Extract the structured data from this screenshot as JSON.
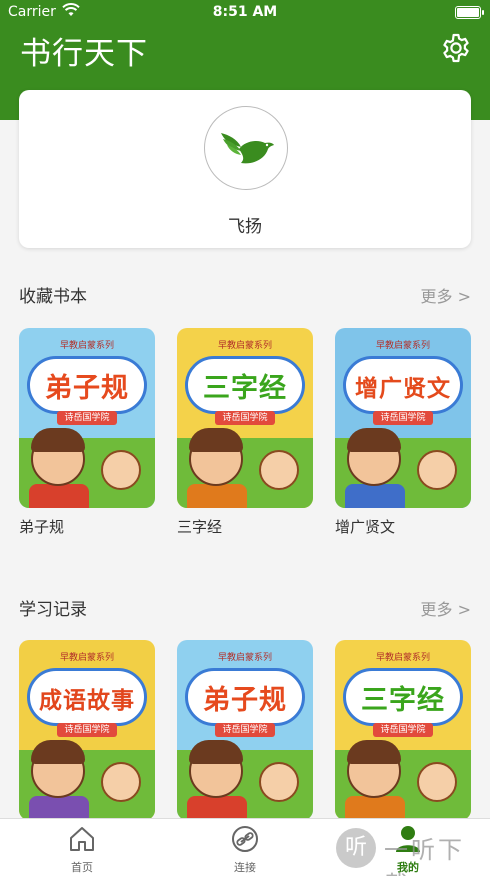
{
  "status_bar": {
    "carrier": "Carrier",
    "time": "8:51 AM"
  },
  "header": {
    "title": "书行天下",
    "settings_icon": "gear-icon"
  },
  "profile": {
    "username": "飞扬",
    "avatar_icon": "bird-book-logo"
  },
  "favorites": {
    "title": "收藏书本",
    "more": "更多 >",
    "books": [
      {
        "cover_series": "早教启蒙系列",
        "cover_title": "弟子规",
        "cover_publisher": "诗岳国学院",
        "label": "弟子规",
        "title_color": "#e64a1e",
        "sky_color": "#8fd0ef",
        "robe_color": "#d8402c"
      },
      {
        "cover_series": "早教启蒙系列",
        "cover_title": "三字经",
        "cover_publisher": "诗岳国学院",
        "label": "三字经",
        "title_color": "#3aa51c",
        "sky_color": "#f4d24a",
        "robe_color": "#e07a1c"
      },
      {
        "cover_series": "早教启蒙系列",
        "cover_title": "增广贤文",
        "cover_publisher": "诗岳国学院",
        "label": "增广贤文",
        "title_color": "#e44a1c",
        "sky_color": "#7fc4ea",
        "robe_color": "#3f6ec9"
      }
    ]
  },
  "history": {
    "title": "学习记录",
    "more": "更多 >",
    "books": [
      {
        "cover_series": "早教启蒙系列",
        "cover_title": "成语故事",
        "cover_publisher": "诗岳国学院",
        "title_color": "#e2461c",
        "sky_color": "#f2cf45",
        "robe_color": "#7a4fb0"
      },
      {
        "cover_series": "早教启蒙系列",
        "cover_title": "弟子规",
        "cover_publisher": "诗岳国学院",
        "title_color": "#e64a1e",
        "sky_color": "#8fd0ef",
        "robe_color": "#d8402c"
      },
      {
        "cover_series": "早教启蒙系列",
        "cover_title": "三字经",
        "cover_publisher": "诗岳国学院",
        "title_color": "#3aa51c",
        "sky_color": "#f4d24a",
        "robe_color": "#e07a1c"
      }
    ]
  },
  "tabbar": {
    "tabs": [
      {
        "label": "首页",
        "icon": "home-icon"
      },
      {
        "label": "连接",
        "icon": "link-icon"
      },
      {
        "label": "我的",
        "icon": "person-icon"
      }
    ],
    "active_index": 2
  },
  "watermark": {
    "text": "一听下载",
    "icon_glyph": "听"
  },
  "colors": {
    "brand": "#3a8c1f",
    "background": "#f4f4f4",
    "muted": "#999999"
  }
}
